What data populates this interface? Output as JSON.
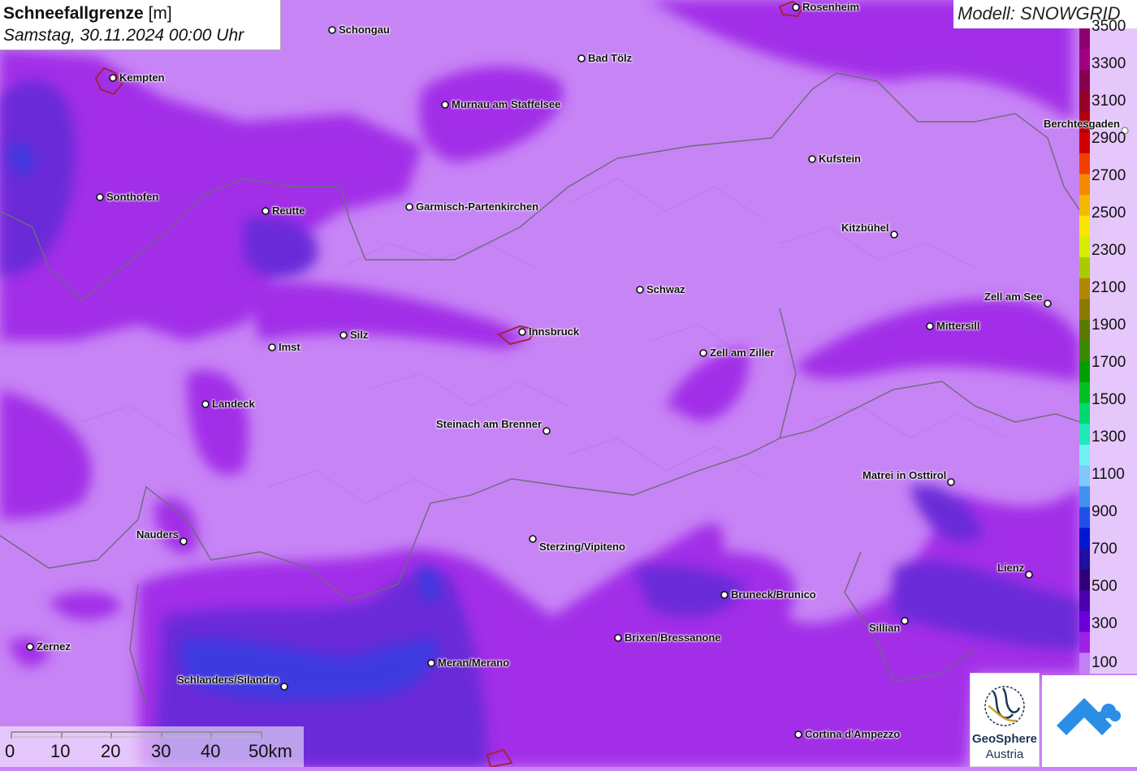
{
  "title": {
    "name": "Schneefallgrenze",
    "unit": "[m]",
    "datetime": "Samstag, 30.11.2024 00:00 Uhr"
  },
  "model": {
    "label": "Modell: SNOWGRID"
  },
  "legend": {
    "labels": [
      "3500",
      "3300",
      "3100",
      "2900",
      "2700",
      "2500",
      "2300",
      "2100",
      "1900",
      "1700",
      "1500",
      "1300",
      "1100",
      "900",
      "700",
      "500",
      "300",
      "100"
    ],
    "colors": [
      "#8d006f",
      "#a00080",
      "#8a0050",
      "#95002a",
      "#b0000a",
      "#d40000",
      "#f04000",
      "#f58a00",
      "#f5b800",
      "#fbe500",
      "#d6ec00",
      "#a8cc00",
      "#b08800",
      "#8a7a00",
      "#5a7a00",
      "#3a8a00",
      "#00a000",
      "#00c020",
      "#00d870",
      "#20e8b8",
      "#70f0f0",
      "#80c8f8",
      "#4090f0",
      "#2050e8",
      "#0018d0",
      "#2010a0",
      "#30007a",
      "#4a00b0",
      "#6a00d8",
      "#a020e8",
      "#c080f8"
    ]
  },
  "cities": [
    {
      "name": "Rosenheim"
    },
    {
      "name": "Schongau"
    },
    {
      "name": "Bad Tölz"
    },
    {
      "name": "Kempten"
    },
    {
      "name": "Murnau am Staffelsee"
    },
    {
      "name": "Berchtesgaden"
    },
    {
      "name": "Kufstein"
    },
    {
      "name": "Sonthofen"
    },
    {
      "name": "Reutte"
    },
    {
      "name": "Garmisch-Partenkirchen"
    },
    {
      "name": "Kitzbühel"
    },
    {
      "name": "Schwaz"
    },
    {
      "name": "Zell am See"
    },
    {
      "name": "Mittersill"
    },
    {
      "name": "Innsbruck"
    },
    {
      "name": "Silz"
    },
    {
      "name": "Imst"
    },
    {
      "name": "Zell am Ziller"
    },
    {
      "name": "Landeck"
    },
    {
      "name": "Steinach am Brenner"
    },
    {
      "name": "Matrei in Osttirol"
    },
    {
      "name": "Nauders"
    },
    {
      "name": "Sterzing/Vipiteno"
    },
    {
      "name": "Lienz"
    },
    {
      "name": "Bruneck/Brunico"
    },
    {
      "name": "Sillian"
    },
    {
      "name": "Brixen/Bressanone"
    },
    {
      "name": "Zernez"
    },
    {
      "name": "Meran/Merano"
    },
    {
      "name": "Schlanders/Silandro"
    },
    {
      "name": "Cortina d'Ampezzo"
    }
  ],
  "scale": {
    "labels": [
      "0",
      "10",
      "20",
      "30",
      "40",
      "50km"
    ]
  },
  "logos": {
    "geosphere_name": "GeoSphere",
    "geosphere_sub": "Austria"
  }
}
